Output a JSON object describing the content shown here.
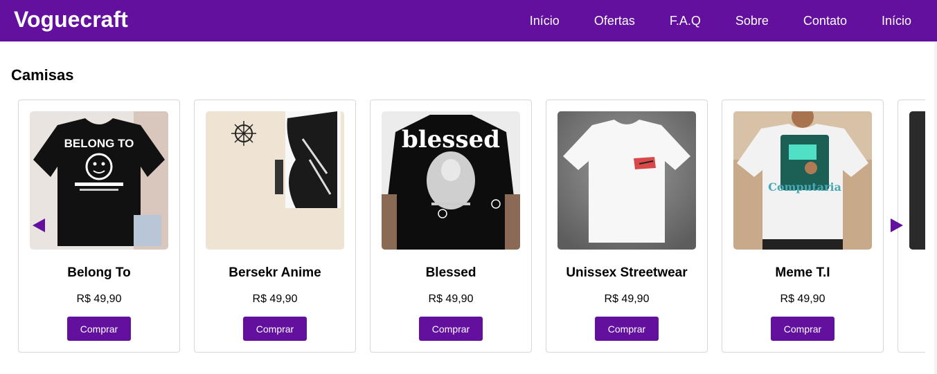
{
  "header": {
    "brand": "Voguecraft",
    "nav": [
      "Início",
      "Ofertas",
      "F.A.Q",
      "Sobre",
      "Contato",
      "Início"
    ]
  },
  "section": {
    "title": "Camisas"
  },
  "products": [
    {
      "name": "Belong To",
      "price": "R$ 49,90",
      "button": "Comprar",
      "shirt_color": "#111111",
      "image_text": "BELONG TO"
    },
    {
      "name": "Bersekr Anime",
      "price": "R$ 49,90",
      "button": "Comprar",
      "shirt_color": "#efe3d3",
      "image_text": ""
    },
    {
      "name": "Blessed",
      "price": "R$ 49,90",
      "button": "Comprar",
      "shirt_color": "#111111",
      "image_text": "blessed"
    },
    {
      "name": "Unissex Streetwear",
      "price": "R$ 49,90",
      "button": "Comprar",
      "shirt_color": "#f5f5f5",
      "image_text": ""
    },
    {
      "name": "Meme T.I",
      "price": "R$ 49,90",
      "button": "Comprar",
      "shirt_color": "#f0f0f0",
      "image_text": "Computaria"
    }
  ],
  "colors": {
    "primary": "#63109e",
    "white": "#ffffff",
    "border": "#d6d6d6"
  },
  "icons": {
    "prev": "triangle-left-icon",
    "next": "triangle-right-icon"
  }
}
